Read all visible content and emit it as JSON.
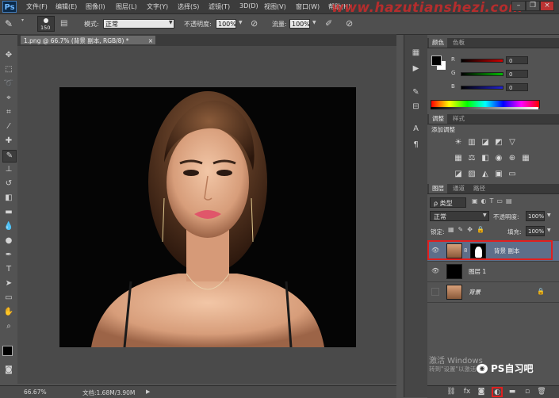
{
  "app": {
    "logo": "Ps"
  },
  "menu": [
    "文件(F)",
    "编辑(E)",
    "图像(I)",
    "图层(L)",
    "文字(Y)",
    "选择(S)",
    "滤镜(T)",
    "3D(D)",
    "视图(V)",
    "窗口(W)",
    "帮助(H)"
  ],
  "watermark": "www.hazutianshezi.com",
  "options": {
    "brush_size": "150",
    "mode_label": "模式:",
    "mode_value": "正常",
    "opacity_label": "不透明度:",
    "opacity_value": "100%",
    "flow_label": "流量:",
    "flow_value": "100%"
  },
  "document_tab": {
    "title": "1.png @ 66.7% (背景 副本, RGB/8) *",
    "close": "×"
  },
  "status": {
    "zoom": "66.67%",
    "doc_info": "文档:1.68M/3.90M"
  },
  "color_panel": {
    "tabs": [
      "颜色",
      "色板"
    ],
    "channels": [
      {
        "name": "R",
        "value": "0",
        "color": "#cc2222"
      },
      {
        "name": "G",
        "value": "0",
        "color": "#22aa22"
      },
      {
        "name": "B",
        "value": "0",
        "color": "#2233cc"
      }
    ]
  },
  "adjust_panel": {
    "tabs": [
      "调整",
      "样式"
    ],
    "title": "添加调整"
  },
  "layers_panel": {
    "tabs": [
      "图层",
      "通道",
      "路径"
    ],
    "kind_label": "ρ 类型",
    "blend_mode": "正常",
    "opacity_label": "不透明度:",
    "opacity_value": "100%",
    "lock_label": "锁定:",
    "fill_label": "填充:",
    "fill_value": "100%",
    "layers": [
      {
        "name": "背景 副本",
        "selected": true
      },
      {
        "name": "图层 1",
        "selected": false
      },
      {
        "name": "背景",
        "selected": false
      }
    ]
  },
  "activate": {
    "line1": "激活 Windows",
    "line2": "转到\"设置\"以激活"
  },
  "wechat": {
    "label": "PS自习吧"
  },
  "colors": {
    "accent_red": "#e02020",
    "selected_layer": "#5e6e89",
    "foreground": "#000000",
    "background": "#ffffff"
  }
}
